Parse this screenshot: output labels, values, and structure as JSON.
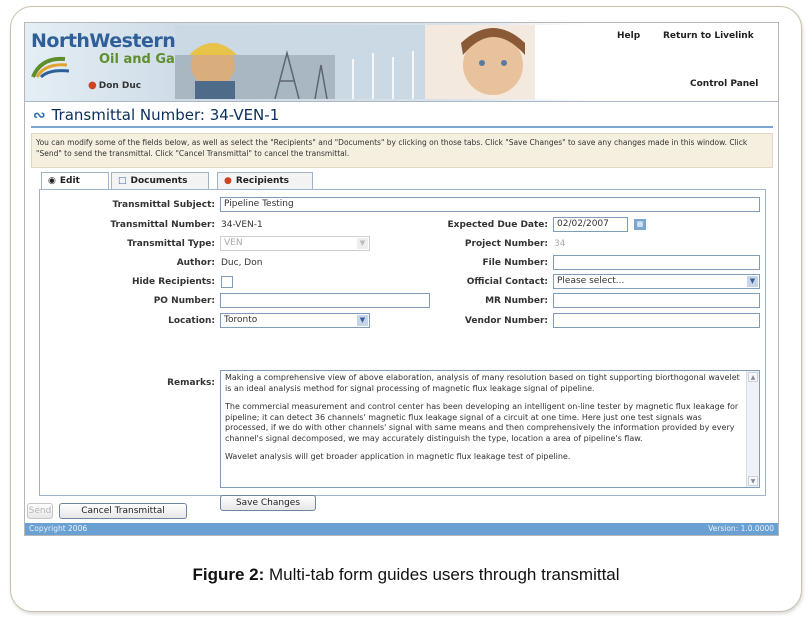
{
  "branding": {
    "logo_line1": "NorthWestern",
    "logo_line2": "Oil and Gas",
    "user_name": "Don Duc"
  },
  "nav": {
    "help": "Help",
    "return_livelink": "Return to Livelink",
    "control_panel": "Control Panel"
  },
  "page": {
    "title": "Transmittal Number: 34-VEN-1",
    "instructions": "You can modify some of the fields below, as well as select the \"Recipients\" and \"Documents\" by clicking on those tabs. Click \"Save Changes\" to save any changes made in this window. Click \"Send\" to send the transmittal. Click \"Cancel Transmittal\" to cancel the transmittal."
  },
  "tabs": [
    {
      "label": "Edit",
      "icon": "eye-icon",
      "active": true
    },
    {
      "label": "Documents",
      "icon": "document-icon",
      "active": false
    },
    {
      "label": "Recipients",
      "icon": "people-icon",
      "active": false
    }
  ],
  "form": {
    "subject_label": "Transmittal Subject:",
    "subject_value": "Pipeline Testing",
    "number_label": "Transmittal Number:",
    "number_value": "34-VEN-1",
    "type_label": "Transmittal Type:",
    "type_value": "VEN",
    "author_label": "Author:",
    "author_value": "Duc, Don",
    "hide_label": "Hide Recipients:",
    "po_label": "PO Number:",
    "po_value": "",
    "location_label": "Location:",
    "location_value": "Toronto",
    "due_label": "Expected Due Date:",
    "due_value": "02/02/2007",
    "project_label": "Project Number:",
    "project_value": "34",
    "file_label": "File Number:",
    "file_value": "",
    "contact_label": "Official Contact:",
    "contact_value": "Please select...",
    "mr_label": "MR Number:",
    "mr_value": "",
    "vendor_label": "Vendor Number:",
    "vendor_value": "",
    "remarks_label": "Remarks:",
    "remarks_p1": "Making a comprehensive view of above elaboration, analysis of many resolution based on tight supporting biorthogonal wavelet is an ideal analysis method for signal processing of magnetic flux leakage signal of pipeline.",
    "remarks_p2": "The commercial measurement and control center has been developing an intelligent on-line tester by magnetic flux leakage for pipeline; it can detect 36 channels' magnetic flux leakage signal of a circuit at one time. Here just one test signals was processed, if we do with other channels' signal with same means and then comprehensively the information provided by every channel's signal decomposed, we may accurately distinguish the type, location a area of pipeline's flaw.",
    "remarks_p3": "Wavelet analysis will get broader application in magnetic flux leakage test of pipeline.",
    "save_button": "Save Changes"
  },
  "actions": {
    "send": "Send",
    "cancel": "Cancel Transmittal"
  },
  "footer": {
    "copyright": "Copyright 2006",
    "version": "Version: 1.0.0000"
  },
  "caption": {
    "bold": "Figure 2:",
    "text": " Multi-tab form guides users through transmittal"
  },
  "colors": {
    "title": "#0b2f5a",
    "accent": "#6aa0d2",
    "logo_blue": "#2f5f98",
    "logo_green": "#5e8f2c"
  }
}
